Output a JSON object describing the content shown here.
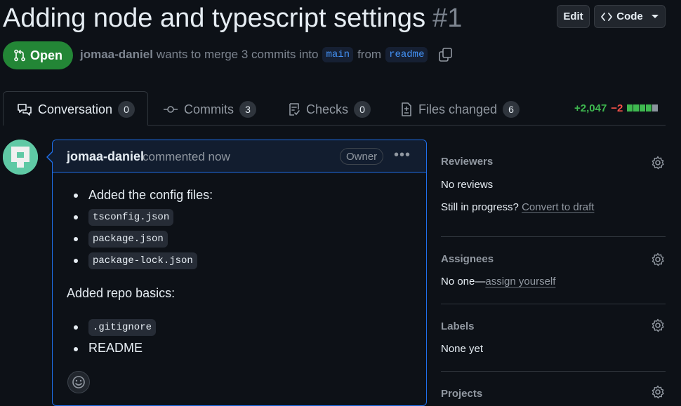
{
  "header": {
    "title": "Adding node and typescript settings",
    "number": "#1",
    "edit_label": "Edit",
    "code_label": "Code"
  },
  "status": {
    "state": "Open",
    "author": "jomaa-daniel",
    "text_before": "wants to merge 3 commits into",
    "base_branch": "main",
    "from_text": "from",
    "head_branch": "readme"
  },
  "tabs": [
    {
      "label": "Conversation",
      "count": "0",
      "icon": "comment-discussion-icon"
    },
    {
      "label": "Commits",
      "count": "3",
      "icon": "git-commit-icon"
    },
    {
      "label": "Checks",
      "count": "0",
      "icon": "checklist-icon"
    },
    {
      "label": "Files changed",
      "count": "6",
      "icon": "file-diff-icon"
    }
  ],
  "diffstat": {
    "additions": "+2,047",
    "deletions": "−2",
    "blocks": [
      "#3fb950",
      "#3fb950",
      "#3fb950",
      "#3fb950",
      "#8b949e"
    ]
  },
  "comment": {
    "author": "jomaa-daniel",
    "time": "commented now",
    "badge": "Owner",
    "intro_item": "Added the config files:",
    "config_files": [
      "tsconfig.json",
      "package.json",
      "package-lock.json"
    ],
    "repo_basics_heading": "Added repo basics:",
    "basics_code": ".gitignore",
    "basics_text": "README"
  },
  "sidebar": {
    "reviewers": {
      "heading": "Reviewers",
      "value": "No reviews",
      "progress_text": "Still in progress?",
      "convert_link": "Convert to draft"
    },
    "assignees": {
      "heading": "Assignees",
      "value": "No one—",
      "assign_link": "assign yourself"
    },
    "labels": {
      "heading": "Labels",
      "value": "None yet"
    },
    "projects": {
      "heading": "Projects"
    }
  },
  "colors": {
    "background": "#0d1117",
    "open_green": "#238636",
    "accent_blue": "#1f6feb",
    "link_blue": "#4493f8"
  }
}
